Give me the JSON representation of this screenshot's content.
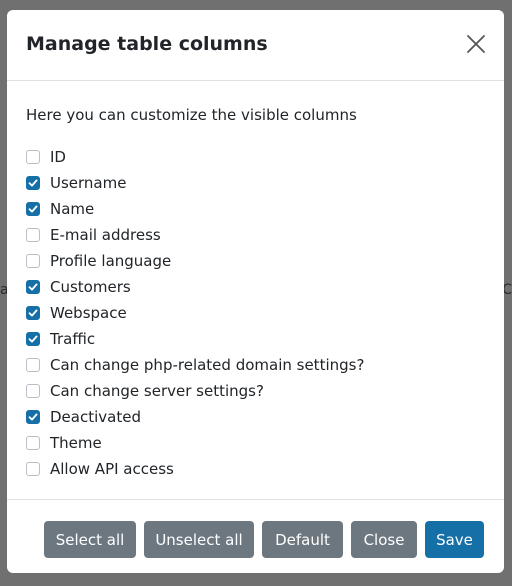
{
  "background": {
    "left_fragment": "a",
    "right_fragment": "C"
  },
  "modal": {
    "title": "Manage table columns",
    "intro": "Here you can customize the visible columns",
    "columns": [
      {
        "label": "ID",
        "checked": false
      },
      {
        "label": "Username",
        "checked": true
      },
      {
        "label": "Name",
        "checked": true
      },
      {
        "label": "E-mail address",
        "checked": false
      },
      {
        "label": "Profile language",
        "checked": false
      },
      {
        "label": "Customers",
        "checked": true
      },
      {
        "label": "Webspace",
        "checked": true
      },
      {
        "label": "Traffic",
        "checked": true
      },
      {
        "label": "Can change php-related domain settings?",
        "checked": false
      },
      {
        "label": "Can change server settings?",
        "checked": false
      },
      {
        "label": "Deactivated",
        "checked": true
      },
      {
        "label": "Theme",
        "checked": false
      },
      {
        "label": "Allow API access",
        "checked": false
      }
    ],
    "buttons": {
      "select_all": "Select all",
      "unselect_all": "Unselect all",
      "default": "Default",
      "close": "Close",
      "save": "Save"
    }
  },
  "colors": {
    "primary": "#1670a8",
    "secondary": "#6c7780",
    "backdrop": "#707070"
  },
  "icons": {
    "close": "close-icon",
    "check": "checkmark-icon"
  }
}
